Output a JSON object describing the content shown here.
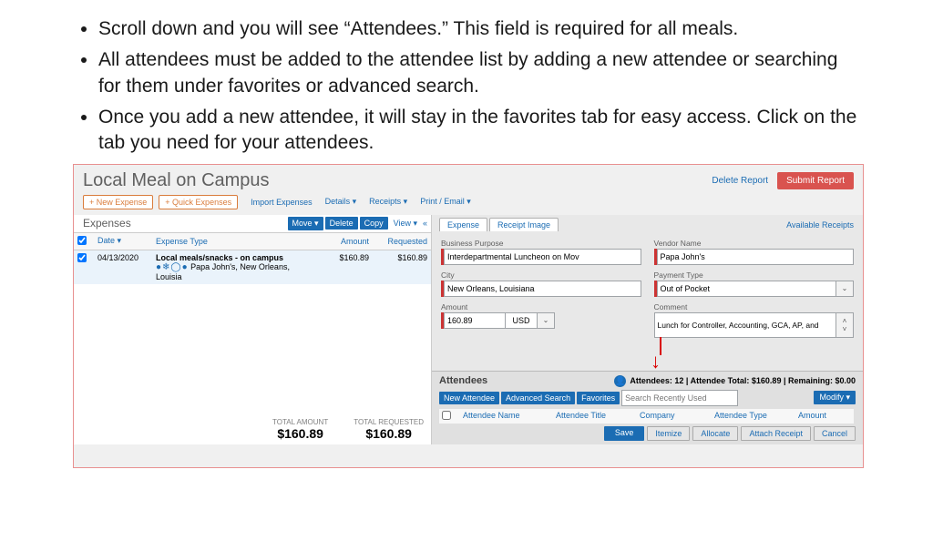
{
  "instructions": {
    "b1": "Scroll down and you will see “Attendees.” This field is required for all meals.",
    "b2": "All attendees must be added to the attendee list by adding a new attendee or searching for them under favorites or advanced search.",
    "b3": "Once you add a new attendee, it will stay in the favorites tab for easy access. Click on the tab you need for your attendees."
  },
  "ss": {
    "title": "Local Meal on Campus",
    "deleteReport": "Delete Report",
    "submitReport": "Submit Report",
    "newExpense": "+ New Expense",
    "quickExpenses": "+ Quick Expenses",
    "importExpenses": "Import Expenses",
    "details": "Details ▾",
    "receipts": "Receipts ▾",
    "printEmail": "Print / Email ▾",
    "expensesTitle": "Expenses",
    "move": "Move ▾",
    "delete": "Delete",
    "copy": "Copy",
    "view": "View ▾",
    "collapse": "«",
    "cols": {
      "date": "Date ▾",
      "type": "Expense Type",
      "amount": "Amount",
      "requested": "Requested"
    },
    "row": {
      "date": "04/13/2020",
      "type": "Local meals/snacks - on campus",
      "detail": "Papa John's, New Orleans, Louisia",
      "amount": "$160.89",
      "requested": "$160.89"
    },
    "totals": {
      "tl": "TOTAL AMOUNT",
      "ta": "$160.89",
      "rl": "TOTAL REQUESTED",
      "ra": "$160.89"
    },
    "tabs": {
      "expense": "Expense",
      "receipt": "Receipt Image"
    },
    "avail": "Available Receipts",
    "f": {
      "bpl": "Business Purpose",
      "bpv": "Interdepartmental Luncheon on Mov",
      "vnl": "Vendor Name",
      "vnv": "Papa John's",
      "cityl": "City",
      "cityv": "New Orleans, Louisiana",
      "ptl": "Payment Type",
      "ptv": "Out of Pocket",
      "amtl": "Amount",
      "amtv": "160.89",
      "usd": "USD",
      "cml": "Comment",
      "cmv": "Lunch for Controller, Accounting, GCA, AP, and"
    },
    "att": {
      "title": "Attendees",
      "info": "Attendees: 12  |  Attendee Total: $160.89  |  Remaining: $0.00",
      "newA": "New Attendee",
      "adv": "Advanced Search",
      "fav": "Favorites",
      "searchPh": "Search Recently Used",
      "modify": "Modify ▾",
      "c1": "Attendee Name",
      "c2": "Attendee Title",
      "c3": "Company",
      "c4": "Attendee Type",
      "c5": "Amount",
      "save": "Save",
      "itemize": "Itemize",
      "allocate": "Allocate",
      "attach": "Attach Receipt",
      "cancel": "Cancel"
    }
  }
}
